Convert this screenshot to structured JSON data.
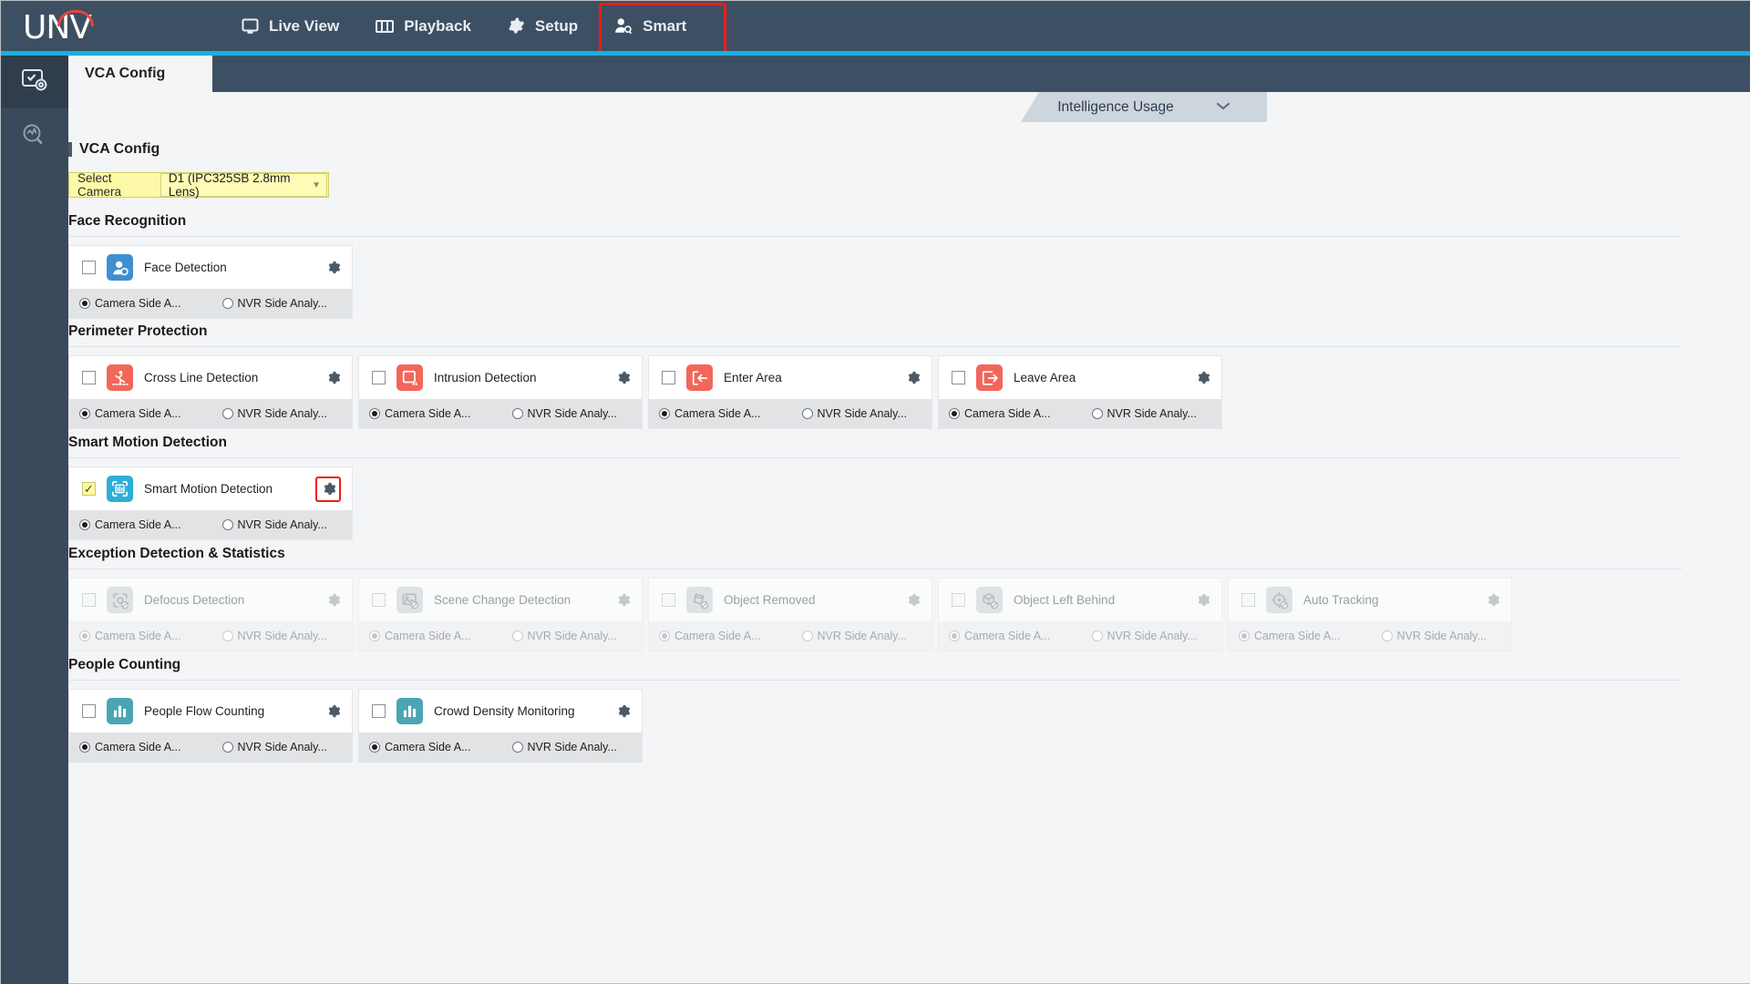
{
  "brand": {
    "name": "UNV",
    "accent_color": "#16b0e0",
    "highlight_color": "#ee1b11"
  },
  "topnav": {
    "items": [
      {
        "label": "Live View",
        "icon": "monitor-icon",
        "active": false
      },
      {
        "label": "Playback",
        "icon": "filmstrip-icon",
        "active": false
      },
      {
        "label": "Setup",
        "icon": "gear-icon",
        "active": false
      },
      {
        "label": "Smart",
        "icon": "person-search-icon",
        "active": true
      }
    ]
  },
  "rail": {
    "items": [
      {
        "icon": "vca-config-icon",
        "selected": true
      },
      {
        "icon": "search-analytics-icon",
        "selected": false
      }
    ]
  },
  "tab": {
    "label": "VCA Config"
  },
  "intelligence_usage": {
    "label": "Intelligence Usage",
    "icon": "chevron-down-icon"
  },
  "page": {
    "title": "VCA Config",
    "camera_selector": {
      "label": "Select Camera",
      "value": "D1 (IPC325SB 2.8mm Lens)",
      "caret": "▼"
    }
  },
  "radio_labels": {
    "camera_side": "Camera Side A...",
    "nvr_side": "NVR Side Analy..."
  },
  "groups": [
    {
      "title": "Face Recognition",
      "cards": [
        {
          "title": "Face Detection",
          "icon": "face-detection-icon",
          "icon_color": "blue",
          "checked": false,
          "disabled": false,
          "gear_highlighted": false,
          "analysis": "camera"
        }
      ]
    },
    {
      "title": "Perimeter Protection",
      "cards": [
        {
          "title": "Cross Line Detection",
          "icon": "cross-line-icon",
          "icon_color": "red",
          "checked": false,
          "disabled": false,
          "gear_highlighted": false,
          "analysis": "camera"
        },
        {
          "title": "Intrusion Detection",
          "icon": "intrusion-icon",
          "icon_color": "red",
          "checked": false,
          "disabled": false,
          "gear_highlighted": false,
          "analysis": "camera"
        },
        {
          "title": "Enter Area",
          "icon": "enter-area-icon",
          "icon_color": "red",
          "checked": false,
          "disabled": false,
          "gear_highlighted": false,
          "analysis": "camera"
        },
        {
          "title": "Leave Area",
          "icon": "leave-area-icon",
          "icon_color": "red",
          "checked": false,
          "disabled": false,
          "gear_highlighted": false,
          "analysis": "camera"
        }
      ]
    },
    {
      "title": "Smart Motion Detection",
      "cards": [
        {
          "title": "Smart Motion Detection",
          "icon": "smart-motion-icon",
          "icon_color": "cyan",
          "checked": true,
          "disabled": false,
          "gear_highlighted": true,
          "analysis": "camera"
        }
      ]
    },
    {
      "title": "Exception Detection & Statistics",
      "cards": [
        {
          "title": "Defocus Detection",
          "icon": "defocus-icon",
          "icon_color": "grey",
          "checked": false,
          "disabled": true,
          "gear_highlighted": false,
          "analysis": "camera"
        },
        {
          "title": "Scene Change Detection",
          "icon": "scene-change-icon",
          "icon_color": "grey",
          "checked": false,
          "disabled": true,
          "gear_highlighted": false,
          "analysis": "camera"
        },
        {
          "title": "Object Removed",
          "icon": "object-removed-icon",
          "icon_color": "grey",
          "checked": false,
          "disabled": true,
          "gear_highlighted": false,
          "analysis": "camera"
        },
        {
          "title": "Object Left Behind",
          "icon": "object-left-behind-icon",
          "icon_color": "grey",
          "checked": false,
          "disabled": true,
          "gear_highlighted": false,
          "analysis": "camera"
        },
        {
          "title": "Auto Tracking",
          "icon": "auto-tracking-icon",
          "icon_color": "grey",
          "checked": false,
          "disabled": true,
          "gear_highlighted": false,
          "analysis": "camera"
        }
      ]
    },
    {
      "title": "People Counting",
      "cards": [
        {
          "title": "People Flow Counting",
          "icon": "bar-chart-icon",
          "icon_color": "teal",
          "checked": false,
          "disabled": false,
          "gear_highlighted": false,
          "analysis": "camera"
        },
        {
          "title": "Crowd Density Monitoring",
          "icon": "bar-chart-icon",
          "icon_color": "teal",
          "checked": false,
          "disabled": false,
          "gear_highlighted": false,
          "analysis": "camera"
        }
      ]
    }
  ]
}
